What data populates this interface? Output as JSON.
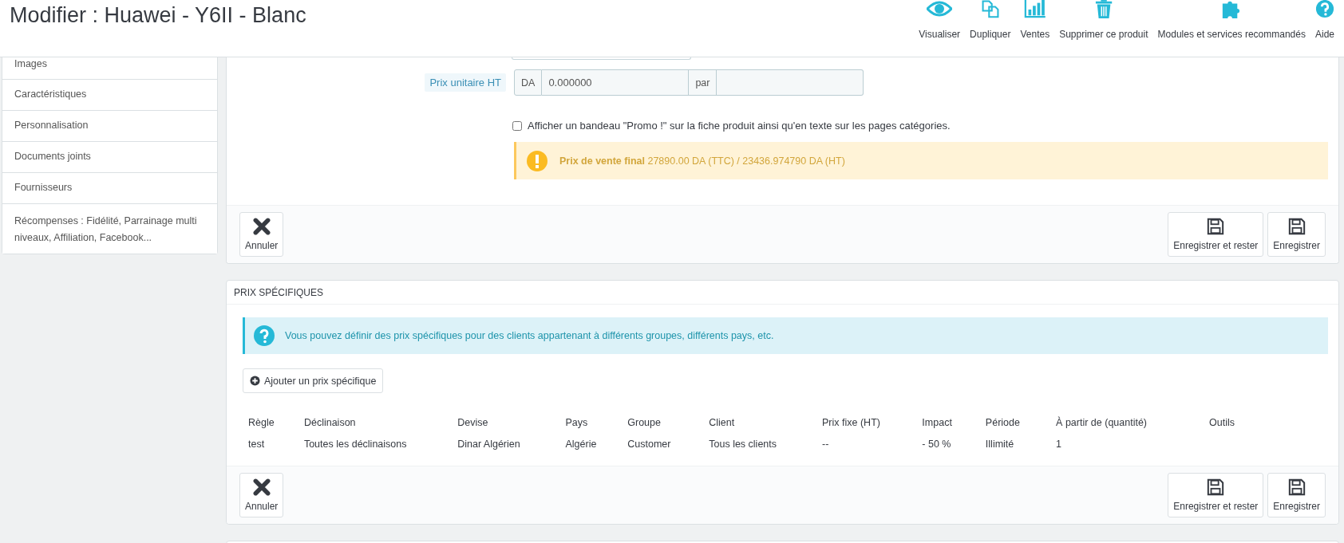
{
  "page": {
    "title": "Modifier : Huawei - Y6II - Blanc"
  },
  "toolbar": [
    {
      "label": "Visualiser",
      "kind": "eye"
    },
    {
      "label": "Dupliquer",
      "kind": "copy"
    },
    {
      "label": "Ventes",
      "kind": "chart"
    },
    {
      "label": "Supprimer ce produit",
      "kind": "trash"
    },
    {
      "label": "Modules et services recommandés",
      "kind": "puzzle"
    },
    {
      "label": "Aide",
      "kind": "help"
    }
  ],
  "sidebar": {
    "items": [
      {
        "label": "Images"
      },
      {
        "label": "Caractéristiques"
      },
      {
        "label": "Personnalisation"
      },
      {
        "label": "Documents joints"
      },
      {
        "label": "Fournisseurs"
      },
      {
        "label": "Récompenses : Fidélité, Parrainage multi niveaux, Affiliation, Facebook..."
      }
    ]
  },
  "price_panel": {
    "unit_price": {
      "label": "Prix unitaire HT",
      "currency": "DA",
      "value": "0.000000",
      "per_label": "par"
    },
    "promo_checkbox": {
      "label": "Afficher un bandeau \"Promo !\" sur la fiche produit ainsi qu'en texte sur les pages catégories.",
      "checked": false
    },
    "final_price_alert": "**Prix de vente final** 27890.00 DA (TTC) / 23436.974790 DA (HT)",
    "footer_buttons": [
      {
        "label": "Annuler",
        "kind": "cancel"
      },
      {
        "label": "Enregistrer et rester",
        "kind": "save"
      },
      {
        "label": "Enregistrer",
        "kind": "save"
      }
    ]
  },
  "specific_prices": {
    "title": "PRIX SPÉCIFIQUES",
    "info": "Vous pouvez définir des prix spécifiques pour des clients appartenant à différents groupes, différents pays, etc.",
    "add_button": "Ajouter un prix spécifique",
    "table": {
      "columns": [
        "Règle",
        "Déclinaison",
        "Devise",
        "Pays",
        "Groupe",
        "Client",
        "Prix fixe (HT)",
        "Impact",
        "Période",
        "À partir de (quantité)",
        "Outils"
      ],
      "rows": [
        [
          "test",
          "Toutes les déclinaisons",
          "Dinar Algérien",
          "Algérie",
          "Customer",
          "Tous les clients",
          "--",
          "- 50 %",
          "Illimité",
          "1"
        ]
      ]
    },
    "footer_buttons": [
      {
        "label": "Annuler",
        "kind": "cancel"
      },
      {
        "label": "Enregistrer et rester",
        "kind": "save"
      },
      {
        "label": "Enregistrer",
        "kind": "save"
      }
    ]
  }
}
